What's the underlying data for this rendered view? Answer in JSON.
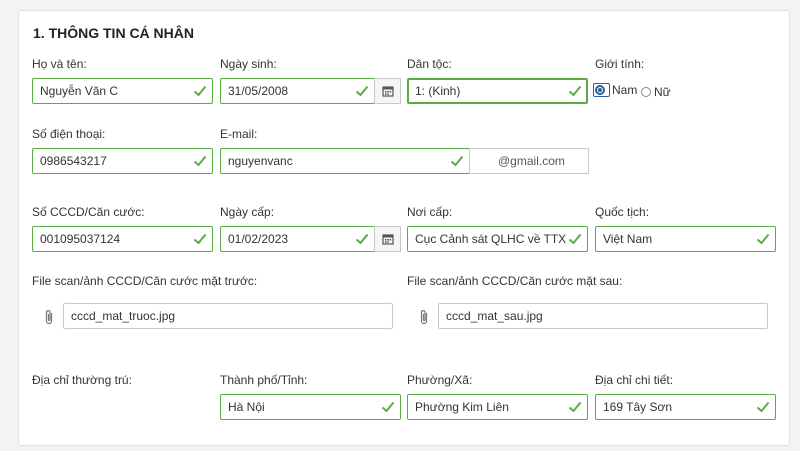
{
  "section_title": "1. THÔNG TIN CÁ NHÂN",
  "row1": {
    "fullname_label": "Họ và tên:",
    "fullname_value": "Nguyễn Văn C",
    "dob_label": "Ngày sinh:",
    "dob_value": "31/05/2008",
    "ethnicity_label": "Dân tộc:",
    "ethnicity_value": "1: (Kinh)",
    "gender_label": "Giới tính:",
    "gender_male": "Nam",
    "gender_female": "Nữ",
    "gender_selected": "Nam"
  },
  "row2": {
    "phone_label": "Số điện thoại:",
    "phone_value": "0986543217",
    "email_label": "E-mail:",
    "email_value": "nguyenvanc",
    "email_domain": "@gmail.com"
  },
  "row3": {
    "id_label": "Số CCCD/Căn cước:",
    "id_value": "001095037124",
    "issue_date_label": "Ngày cấp:",
    "issue_date_value": "01/02/2023",
    "issue_place_label": "Nơi cấp:",
    "issue_place_value": "Cục Cảnh sát QLHC về TTXH",
    "nationality_label": "Quốc tịch:",
    "nationality_value": "Việt Nam"
  },
  "row4": {
    "front_label": "File scan/ảnh CCCD/Căn cước mặt trước:",
    "front_value": "cccd_mat_truoc.jpg",
    "back_label": "File scan/ảnh CCCD/Căn cước mặt sau:",
    "back_value": "cccd_mat_sau.jpg"
  },
  "row5": {
    "address_label": "Địa chỉ thường trú:",
    "city_label": "Thành phố/Tỉnh:",
    "city_value": "Hà Nội",
    "ward_label": "Phường/Xã:",
    "ward_value": "Phường Kim Liên",
    "detail_label": "Địa chỉ chi tiết:",
    "detail_value": "169 Tây Sơn"
  },
  "colors": {
    "valid_green": "#5aaa46",
    "radio_blue": "#2d5fa8"
  },
  "icons": [
    "check-icon",
    "calendar-icon",
    "paperclip-icon"
  ]
}
